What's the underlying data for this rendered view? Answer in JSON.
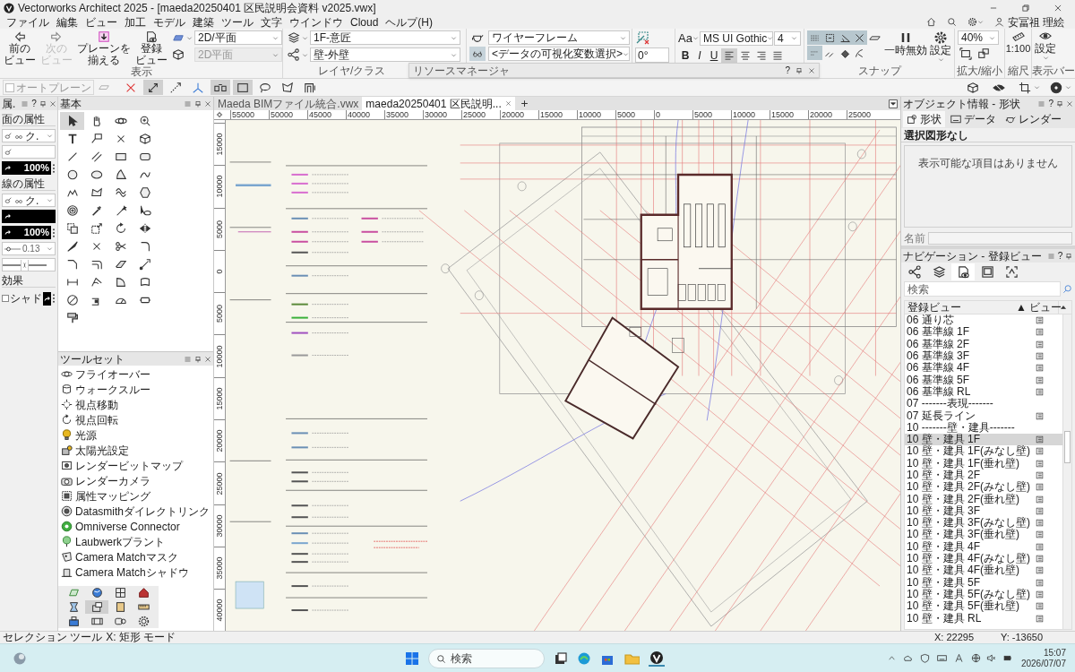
{
  "window": {
    "title": "Vectorworks Architect 2025 - [maeda20250401 区民説明会資料 v2025.vwx]"
  },
  "menu": [
    "ファイル",
    "編集",
    "ビュー",
    "加工",
    "モデル",
    "建築",
    "ツール",
    "文字",
    "ウインドウ",
    "Cloud",
    "ヘルプ(H)"
  ],
  "user": {
    "name": "安冨祖 理絵"
  },
  "ribbon": {
    "view_buttons": [
      {
        "label": "前のビュー",
        "disabled": false
      },
      {
        "label": "次のビュー",
        "disabled": true
      },
      {
        "label": "プレーンを揃える",
        "disabled": false
      },
      {
        "label": "登録ビュー",
        "disabled": false
      }
    ],
    "planes": [
      {
        "value": "2D/平面",
        "disabled": false
      },
      {
        "value": "2D平面",
        "disabled": true
      }
    ],
    "view_group_label": "表示",
    "layer": "1F-意匠",
    "class": "壁-外壁",
    "layer_group_label": "レイヤ/クラス",
    "render_mode": "ワイヤーフレーム",
    "data_viz": {
      "value": "<データの可視化変数選択>",
      "active": true
    },
    "angle": "0°",
    "format_button": "Aa",
    "font": "MS UI Gothic",
    "size": "4",
    "styles": [
      "B",
      "I",
      "U"
    ],
    "alignment": [
      {
        "selected": true
      },
      {
        "selected": false
      },
      {
        "selected": false
      },
      {
        "selected": false
      }
    ],
    "snaps": [
      {
        "selected": true
      },
      {
        "selected": true
      },
      {
        "selected": true
      },
      {
        "selected": true
      },
      {
        "selected": false
      },
      {
        "selected": true
      },
      {
        "selected": false
      },
      {
        "selected": false
      },
      {
        "selected": false
      }
    ],
    "pause_label": "一時無効",
    "snap_settings_label": "設定",
    "snap_group_label": "スナップ",
    "zoom": "40%",
    "zoom_group_label": "拡大/縮小",
    "scale": "1:100",
    "scale_group_label": "縮尺",
    "display_settings_label": "設定",
    "display_group_label": "表示バー"
  },
  "resource_manager": {
    "title": "リソースマネージャ",
    "help": "?"
  },
  "tool_bar": {
    "auto_plane": {
      "label": "オートプレーン",
      "checked": false,
      "disabled": true
    },
    "modes": [
      {
        "selected": false
      },
      {
        "selected": true
      },
      {
        "selected": false
      },
      {
        "selected": false
      },
      {
        "selected": true
      },
      {
        "selected": true
      },
      {
        "selected": false
      },
      {
        "selected": false
      },
      {
        "selected": false
      }
    ]
  },
  "attributes": {
    "title": "属.",
    "help": "?",
    "fill_label": "面の属性",
    "fill_style": "ク.",
    "fill_opacity": "100%",
    "line_label": "線の属性",
    "line_style": "ク.",
    "line_opacity": "100%",
    "line_weight": "0.13",
    "effects_label": "効果",
    "shadow": {
      "label": "シャド",
      "checked": false
    }
  },
  "basic_palette": {
    "title": "基本",
    "tools": [
      {
        "selected": true
      },
      {
        "selected": false
      },
      {
        "selected": false
      },
      {
        "selected": false
      },
      {
        "selected": false
      },
      {
        "selected": false
      },
      {
        "selected": false
      },
      {
        "selected": false
      },
      {
        "selected": false
      },
      {
        "selected": false
      },
      {
        "selected": false
      },
      {
        "selected": false
      },
      {
        "selected": false
      },
      {
        "selected": false
      },
      {
        "selected": false
      },
      {
        "selected": false
      },
      {
        "selected": false
      },
      {
        "selected": false
      },
      {
        "selected": false
      },
      {
        "selected": false
      },
      {
        "selected": false
      },
      {
        "selected": false
      },
      {
        "selected": false
      },
      {
        "selected": false
      },
      {
        "selected": false
      },
      {
        "selected": false
      },
      {
        "selected": false
      },
      {
        "selected": false
      },
      {
        "selected": false
      },
      {
        "selected": false
      },
      {
        "selected": false
      },
      {
        "selected": false
      },
      {
        "selected": false
      },
      {
        "selected": false
      },
      {
        "selected": false
      },
      {
        "selected": false
      },
      {
        "selected": false
      },
      {
        "selected": false
      },
      {
        "selected": false
      },
      {
        "selected": false
      },
      {
        "selected": false
      },
      {
        "selected": false
      },
      {
        "selected": false
      },
      {
        "selected": false
      },
      {
        "selected": false
      }
    ]
  },
  "toolset": {
    "title": "ツールセット",
    "items": [
      "フライオーバー",
      "ウォークスルー",
      "視点移動",
      "視点回転",
      "光源",
      "太陽光設定",
      "レンダービットマップ",
      "レンダーカメラ",
      "属性マッピング",
      "Datasmithダイレクトリンク",
      "Omniverse Connector",
      "Laubwerkプラント",
      "Camera Matchマスク",
      "Camera Matchシャドウ"
    ],
    "sets": [
      {
        "selected": false
      },
      {
        "selected": false
      },
      {
        "selected": false
      },
      {
        "selected": false
      },
      {
        "selected": false
      },
      {
        "selected": true
      },
      {
        "selected": false
      },
      {
        "selected": false
      },
      {
        "selected": false
      },
      {
        "selected": false
      },
      {
        "selected": false
      },
      {
        "selected": false
      }
    ]
  },
  "document_tabs": [
    {
      "label": "Maeda BIMファイル統合.vwx",
      "selected": false
    },
    {
      "label": "maeda20250401 区民説明...",
      "selected": true
    }
  ],
  "rulers": {
    "horizontal": [
      "55000",
      "50000",
      "45000",
      "40000",
      "35000",
      "30000",
      "25000",
      "20000",
      "15000",
      "10000",
      "5000",
      "0",
      "5000",
      "10000",
      "15000",
      "20000",
      "25000"
    ],
    "vertical": [
      "15000",
      "10000",
      "5000",
      "0",
      "5000",
      "10000",
      "15000",
      "20000",
      "25000",
      "30000",
      "35000",
      "40000"
    ]
  },
  "object_info": {
    "title": "オブジェクト情報 - 形状",
    "help": "?",
    "tabs": [
      {
        "label": "形状",
        "selected": true
      },
      {
        "label": "データ",
        "selected": false
      },
      {
        "label": "レンダー",
        "selected": false
      }
    ],
    "selection": "選択図形なし",
    "empty_message": "表示可能な項目はありません",
    "name_label": "名前"
  },
  "navigation": {
    "title": "ナビゲーション - 登録ビュー",
    "help": "?",
    "tabs": [
      {
        "selected": false
      },
      {
        "selected": false
      },
      {
        "selected": true
      },
      {
        "selected": false
      },
      {
        "selected": false
      }
    ],
    "search_placeholder": "検索",
    "columns": [
      "登録ビュー",
      "▲ ビュー"
    ],
    "rows": [
      {
        "label": "06 通り芯",
        "kind": "view",
        "selected": false
      },
      {
        "label": "06 基準線 1F",
        "kind": "view",
        "selected": false
      },
      {
        "label": "06 基準線 2F",
        "kind": "view",
        "selected": false
      },
      {
        "label": "06 基準線 3F",
        "kind": "view",
        "selected": false
      },
      {
        "label": "06 基準線 4F",
        "kind": "view",
        "selected": false
      },
      {
        "label": "06 基準線 5F",
        "kind": "view",
        "selected": false
      },
      {
        "label": "06 基準線 RL",
        "kind": "view",
        "selected": false
      },
      {
        "label": "07 -------表現-------",
        "kind": "separator",
        "selected": false
      },
      {
        "label": "07 延長ライン",
        "kind": "view",
        "selected": false
      },
      {
        "label": "10 -------壁・建具-------",
        "kind": "separator",
        "selected": false
      },
      {
        "label": "10 壁・建具 1F",
        "kind": "view",
        "selected": true
      },
      {
        "label": "10 壁・建具 1F(みなし壁)",
        "kind": "view",
        "selected": false
      },
      {
        "label": "10 壁・建具 1F(垂れ壁)",
        "kind": "view",
        "selected": false
      },
      {
        "label": "10 壁・建具 2F",
        "kind": "view",
        "selected": false
      },
      {
        "label": "10 壁・建具 2F(みなし壁)",
        "kind": "view",
        "selected": false
      },
      {
        "label": "10 壁・建具 2F(垂れ壁)",
        "kind": "view",
        "selected": false
      },
      {
        "label": "10 壁・建具 3F",
        "kind": "view",
        "selected": false
      },
      {
        "label": "10 壁・建具 3F(みなし壁)",
        "kind": "view",
        "selected": false
      },
      {
        "label": "10 壁・建具 3F(垂れ壁)",
        "kind": "view",
        "selected": false
      },
      {
        "label": "10 壁・建具 4F",
        "kind": "view",
        "selected": false
      },
      {
        "label": "10 壁・建具 4F(みなし壁)",
        "kind": "view",
        "selected": false
      },
      {
        "label": "10 壁・建具 4F(垂れ壁)",
        "kind": "view",
        "selected": false
      },
      {
        "label": "10 壁・建具 5F",
        "kind": "view",
        "selected": false
      },
      {
        "label": "10 壁・建具 5F(みなし壁)",
        "kind": "view",
        "selected": false
      },
      {
        "label": "10 壁・建具 5F(垂れ壁)",
        "kind": "view",
        "selected": false
      },
      {
        "label": "10 壁・建具 RL",
        "kind": "view",
        "selected": false
      }
    ]
  },
  "status_bar": {
    "tool": "セレクション ツール",
    "mode": "X: 矩形 モード",
    "x": "X: 22295",
    "y": "Y: -13650"
  },
  "taskbar": {
    "search": "検索",
    "time": "15:07",
    "date": "2026/07/07"
  }
}
